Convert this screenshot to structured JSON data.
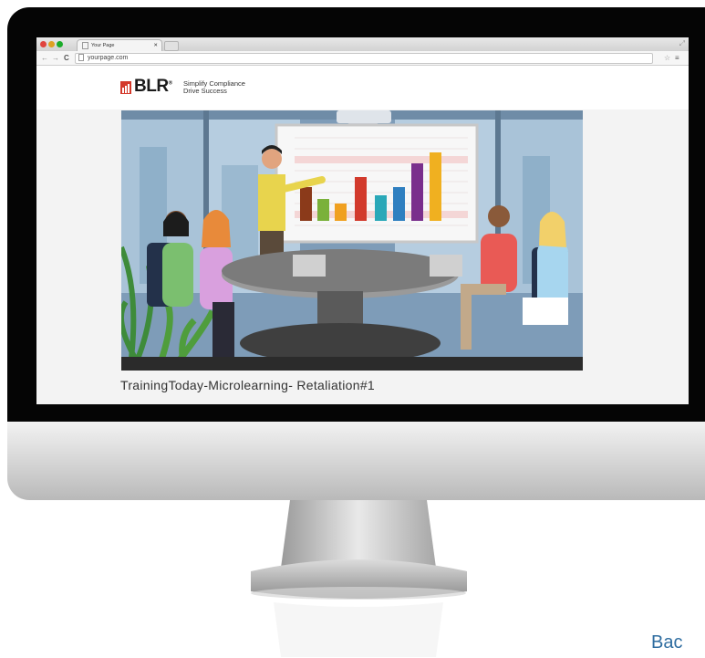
{
  "browser": {
    "tab_title": "Your Page",
    "url": "yourpage.com"
  },
  "brand": {
    "logo_text": "BLR",
    "logo_mark": "®",
    "tagline_line1": "Simplify Compliance",
    "tagline_line2": "Drive Success",
    "accent": "#d43a2c"
  },
  "video": {
    "caption": "TrainingToday-Microlearning- Retaliation#1",
    "chart_bar_colors": [
      "#8b3a1a",
      "#7ab13a",
      "#f0a020",
      "#d23a2c",
      "#2aa8b8",
      "#2f7fc0",
      "#7a2f8c",
      "#f0b020"
    ]
  },
  "footer": {
    "link": "Bac"
  },
  "icons": [
    "back-arrow-icon",
    "forward-arrow-icon",
    "reload-icon",
    "page-icon",
    "star-icon",
    "menu-icon"
  ]
}
